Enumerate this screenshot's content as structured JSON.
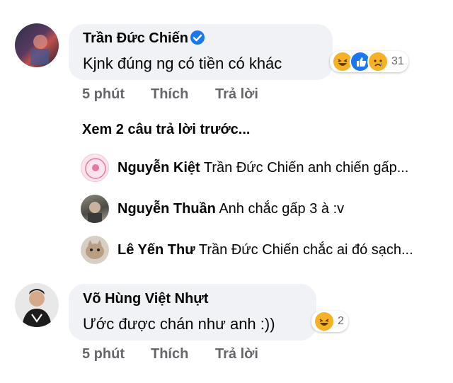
{
  "comment1": {
    "author": "Trần Đức Chiến",
    "text": "Kjnk đúng ng có tiền có khác",
    "reaction_count": "31",
    "reactions": [
      "haha-icon",
      "like-icon",
      "sad-icon"
    ],
    "time": "5 phút",
    "like_label": "Thích",
    "reply_label": "Trả lời"
  },
  "view_previous": "Xem 2 câu trả lời trước...",
  "replies": [
    {
      "author": "Nguyễn Kiệt",
      "text": "Trần Đức Chiến anh chiến gấp..."
    },
    {
      "author": "Nguyễn Thuần",
      "text": "Anh chắc gấp 3 à :v"
    },
    {
      "author": "Lê Yến Thư",
      "text": "Trần Đức Chiến  chắc ai đó sạch..."
    }
  ],
  "comment2": {
    "author": "Võ Hùng Việt Nhựt",
    "text": "Ước được chán như anh :))",
    "reaction_count": "2",
    "reactions": [
      "haha-icon"
    ],
    "time": "5 phút",
    "like_label": "Thích",
    "reply_label": "Trả lời"
  },
  "colors": {
    "bubble": "#f0f2f5",
    "meta": "#65676b",
    "verified": "#1877f2",
    "haha": "#f7b125",
    "like": "#1877f2"
  }
}
